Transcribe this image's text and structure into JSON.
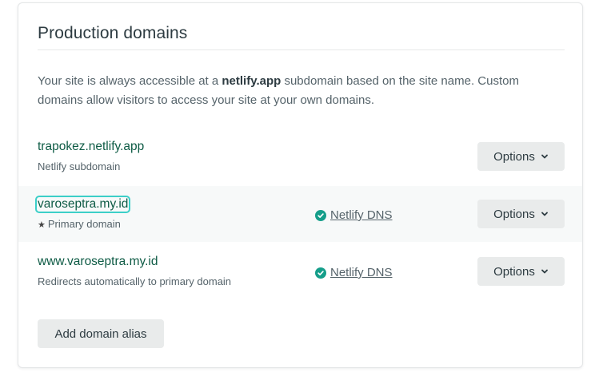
{
  "section": {
    "title": "Production domains",
    "description_prefix": "Your site is always accessible at a ",
    "description_bold": "netlify.app",
    "description_suffix": " subdomain based on the site name. Custom domains allow visitors to access your site at your own domains."
  },
  "domains": [
    {
      "name": "trapokez.netlify.app",
      "subtitle": "Netlify subdomain",
      "dns": "",
      "options_label": "Options"
    },
    {
      "name": "varoseptra.my.id",
      "subtitle": "Primary domain",
      "subtitle_icon": "star-icon",
      "dns": "Netlify DNS",
      "options_label": "Options",
      "focused": true
    },
    {
      "name": "www.varoseptra.my.id",
      "subtitle": "Redirects automatically to primary domain",
      "dns": "Netlify DNS",
      "options_label": "Options"
    }
  ],
  "add_alias_label": "Add domain alias",
  "colors": {
    "domain_text": "#0e5b45",
    "check_badge": "#159e8a",
    "focus_ring": "#3ccfc8",
    "button_bg": "#e9ebeb"
  }
}
